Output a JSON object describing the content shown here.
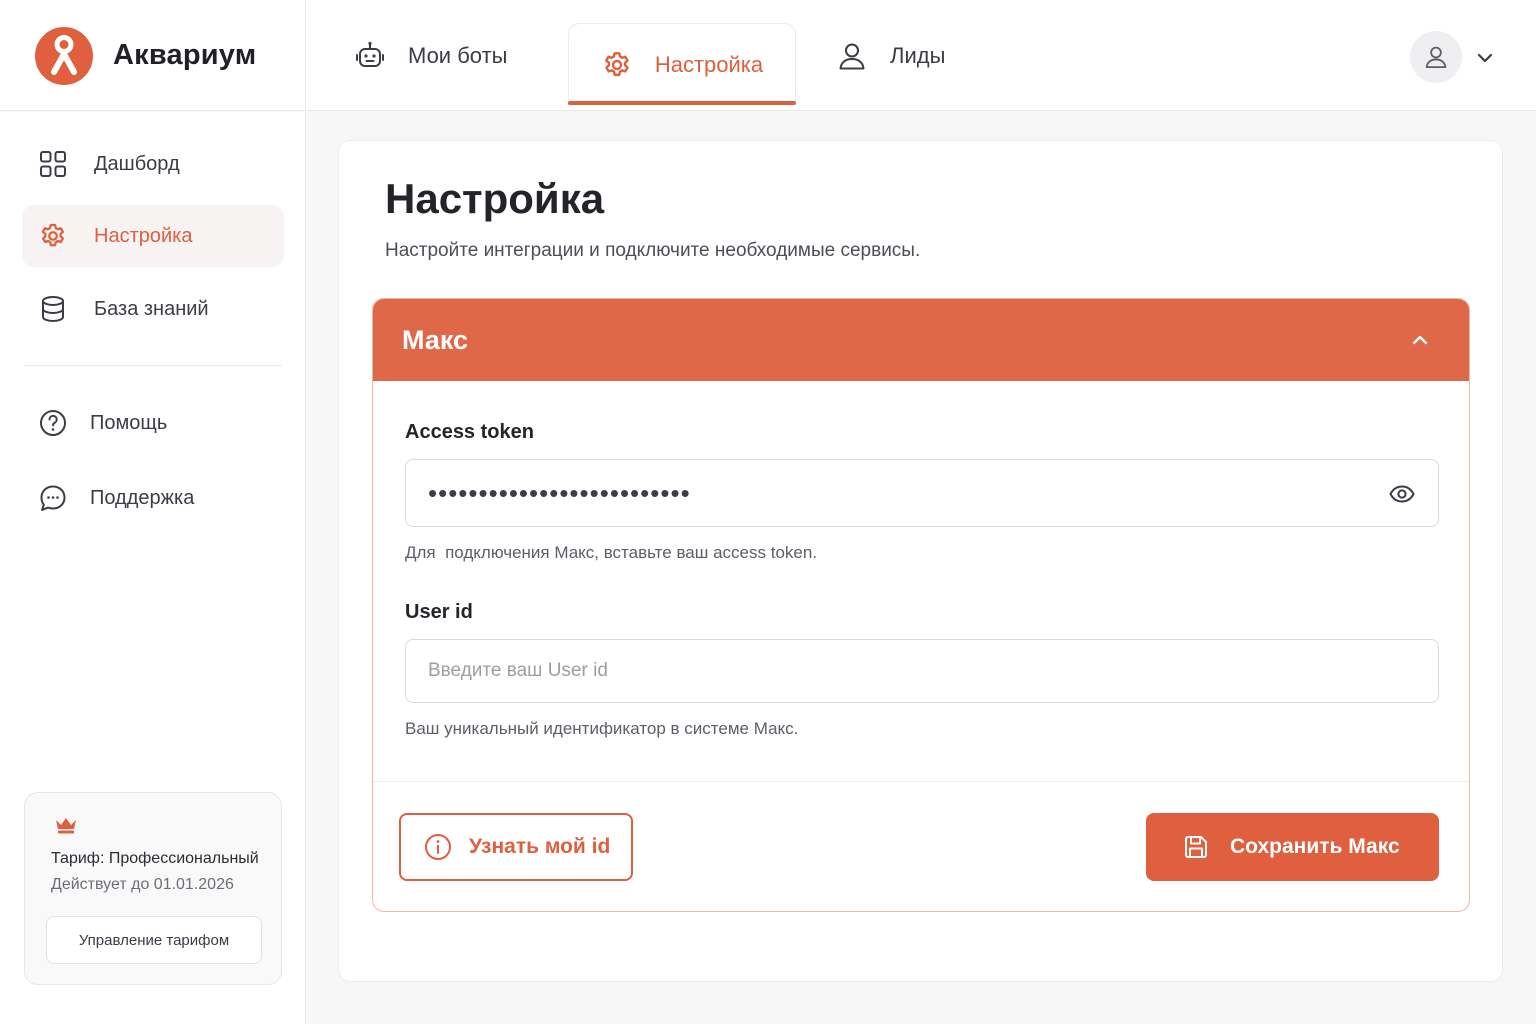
{
  "brand": {
    "name": "Аквариум",
    "logo_icon": "person-logo-icon"
  },
  "colors": {
    "accent": "#e05f3e",
    "panel_header": "#de6848"
  },
  "topnav": {
    "tabs": [
      {
        "label": "Мои боты",
        "icon": "robot-icon",
        "active": false
      },
      {
        "label": "Настройка",
        "icon": "gear-icon",
        "active": true
      },
      {
        "label": "Лиды",
        "icon": "user-icon",
        "active": false
      }
    ]
  },
  "sidebar": {
    "items": [
      {
        "label": "Дашборд",
        "icon": "grid-icon",
        "active": false
      },
      {
        "label": "Настройка",
        "icon": "gear-icon",
        "active": true
      },
      {
        "label": "База знаний",
        "icon": "database-icon",
        "active": false
      },
      {
        "label": "Помощь",
        "icon": "question-icon",
        "active": false
      },
      {
        "label": "Поддержка",
        "icon": "chat-icon",
        "active": false
      }
    ],
    "plan": {
      "title": "Тариф: Профессиональный",
      "valid_until": "Действует до 01.01.2026",
      "manage_label": "Управление тарифом"
    }
  },
  "main": {
    "title": "Настройка",
    "subtitle": "Настройте интеграции и подключите необходимые сервисы.",
    "panel": {
      "title": "Макс",
      "expanded": true,
      "fields": {
        "token": {
          "label": "Access token",
          "value": "••••••••••••••••••••••••••",
          "help": "Для  подключения Макс, вставьте ваш access token."
        },
        "user_id": {
          "label": "User id",
          "value": "",
          "placeholder": "Введите ваш User id",
          "help": "Ваш уникальный идентификатор в системе Макс."
        }
      },
      "actions": {
        "find_id": "Узнать мой id",
        "save": "Сохранить Макс"
      }
    }
  }
}
